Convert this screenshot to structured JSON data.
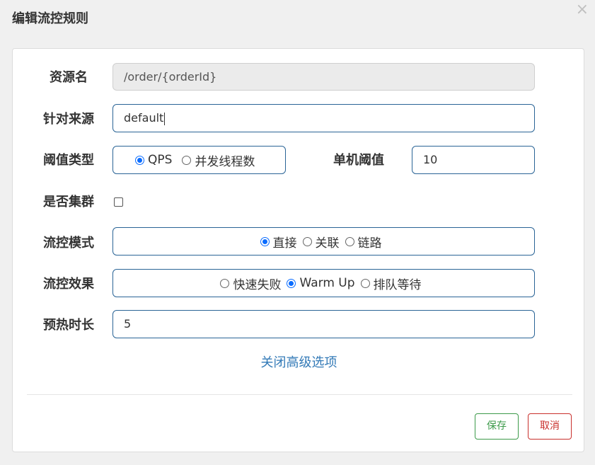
{
  "dialog": {
    "title": "编辑流控规则",
    "close_icon": "×"
  },
  "form": {
    "resource": {
      "label": "资源名",
      "value": "/order/{orderId}"
    },
    "source": {
      "label": "针对来源",
      "value": "default"
    },
    "threshold_type": {
      "label": "阈值类型",
      "options": [
        "QPS",
        "并发线程数"
      ],
      "selected": "QPS"
    },
    "single_threshold": {
      "label": "单机阈值",
      "value": "10"
    },
    "cluster": {
      "label": "是否集群",
      "checked": false
    },
    "flow_mode": {
      "label": "流控模式",
      "options": [
        "直接",
        "关联",
        "链路"
      ],
      "selected": "直接"
    },
    "flow_effect": {
      "label": "流控效果",
      "options": [
        "快速失败",
        "Warm Up",
        "排队等待"
      ],
      "selected": "Warm Up"
    },
    "warmup": {
      "label": "预热时长",
      "value": "5"
    },
    "advanced_link": "关闭高级选项"
  },
  "footer": {
    "save_label": "保存",
    "cancel_label": "取消"
  },
  "colors": {
    "accent": "#337ab7",
    "radio_selected": "#0a6cff",
    "save": "#3c9a4a",
    "cancel": "#c9302c"
  }
}
